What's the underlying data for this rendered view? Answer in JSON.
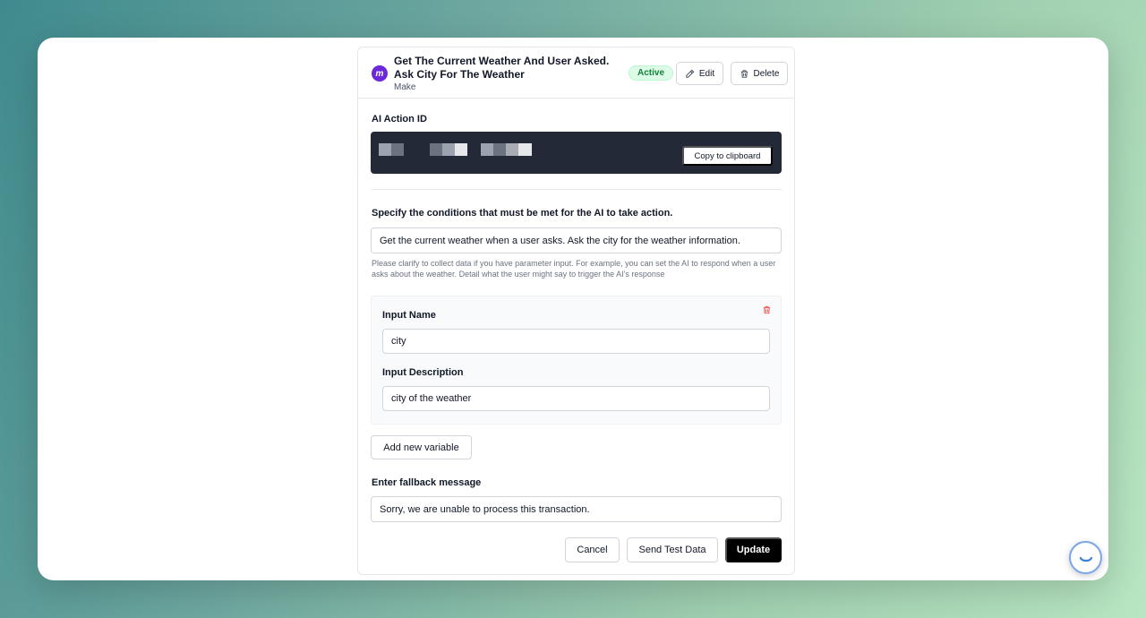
{
  "action": {
    "title": "Get The Current Weather And User Asked. Ask City For The Weather",
    "platform": "Make",
    "logo_letter": "m",
    "status": "Active",
    "edit_label": "Edit",
    "delete_label": "Delete"
  },
  "ai_action_id": {
    "label": "AI Action ID",
    "copy_label": "Copy to clipboard"
  },
  "conditions": {
    "label": "Specify the conditions that must be met for the AI to take action.",
    "value": "Get the current weather when a user asks. Ask the city for the weather information.",
    "help": "Please clarify to collect data if you have parameter input. For example, you can set the AI to respond when a user asks about the weather. Detail what the user might say to trigger the AI's response"
  },
  "variable": {
    "name_label": "Input Name",
    "name_value": "city",
    "description_label": "Input Description",
    "description_value": "city of the weather"
  },
  "add_variable_label": "Add new variable",
  "fallback": {
    "label": "Enter fallback message",
    "value": "Sorry, we are unable to process this transaction."
  },
  "footer": {
    "cancel_label": "Cancel",
    "test_label": "Send Test Data",
    "update_label": "Update"
  },
  "colors": {
    "accent": "#000000",
    "status_green": "#15803d",
    "danger": "#ef4444",
    "id_box": "#232936"
  }
}
